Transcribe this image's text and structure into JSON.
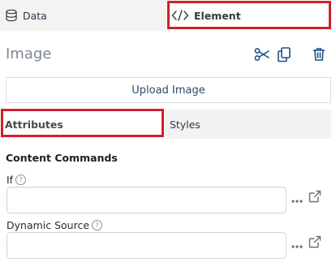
{
  "tabs": {
    "data": {
      "label": "Data",
      "icon": "database-icon"
    },
    "element": {
      "label": "Element",
      "icon": "code-icon"
    }
  },
  "panel": {
    "title": "Image",
    "actions": [
      "scissors-icon",
      "copy-icon",
      "trash-icon"
    ],
    "upload_label": "Upload Image"
  },
  "subtabs": {
    "attributes": "Attributes",
    "styles": "Styles"
  },
  "content_commands": {
    "title": "Content Commands",
    "fields": [
      {
        "label": "If",
        "value": "",
        "help_icon": "help-icon"
      },
      {
        "label": "Dynamic Source",
        "value": "",
        "help_icon": "help-icon"
      }
    ]
  },
  "colors": {
    "highlight": "#d21f2a",
    "accent": "#1f4f8a"
  }
}
